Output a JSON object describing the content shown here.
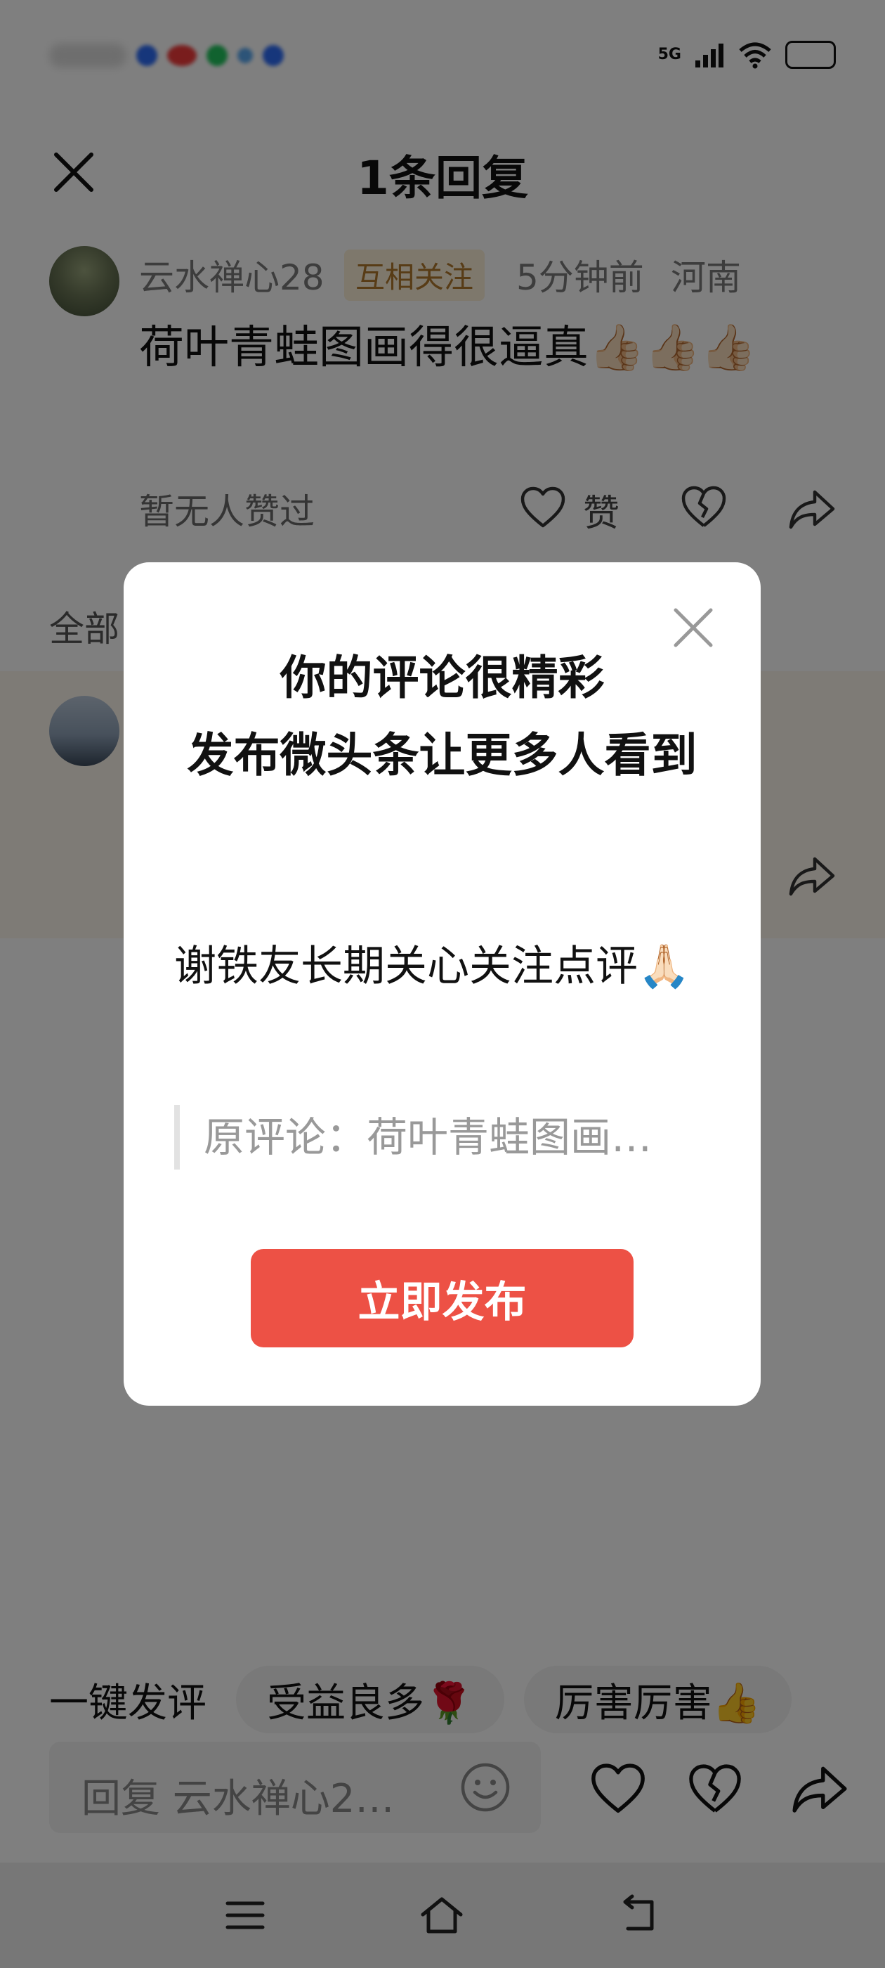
{
  "status_bar": {
    "network": "5G"
  },
  "sheet": {
    "title": "1条回复"
  },
  "comment": {
    "username": "云水禅心28",
    "tag": "互相关注",
    "time": "5分钟前",
    "location": "河南",
    "text": "荷叶青蛙图画得很逼真👍🏻👍🏻👍🏻",
    "no_likes": "暂无人赞过",
    "like_label": "赞"
  },
  "all_replies_label": "全部",
  "quick_comment": {
    "label": "一键发评",
    "chips": [
      "受益良多🌹",
      "厉害厉害👍"
    ]
  },
  "reply_bar": {
    "placeholder": "回复 云水禅心2…"
  },
  "dialog": {
    "title_line1": "你的评论很精彩",
    "title_line2": "发布微头条让更多人看到",
    "body": "谢铁友长期关心关注点评🙏🏻",
    "quote": "原评论：荷叶青蛙图画…",
    "button": "立即发布"
  },
  "colors": {
    "accent": "#ed5145",
    "tag_text": "#b0782c",
    "tag_bg": "#fdf0d8"
  }
}
